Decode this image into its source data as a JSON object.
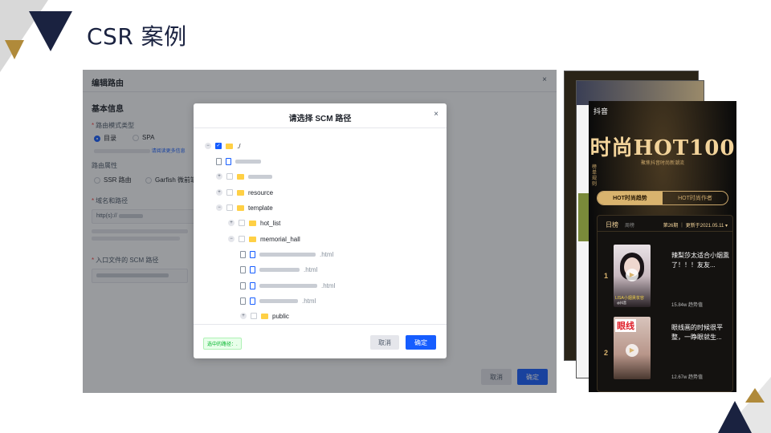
{
  "slide": {
    "title": "CSR 案例"
  },
  "drawer": {
    "title": "编辑路由",
    "close": "×",
    "section": "基本信息",
    "route_mode_label": "路由模式类型",
    "mode_options": [
      "目录",
      "SPA"
    ],
    "mode_hint_link": "请阅读更多信息",
    "route_attr_label": "路由属性",
    "attr_options": [
      "SSR 路由",
      "Garfish 微前端"
    ],
    "domain_label": "域名和路径",
    "domain_prefix": "http(s)://",
    "entry_label": "入口文件的 SCM 路径",
    "cancel": "取消",
    "confirm": "确定"
  },
  "modal": {
    "title": "请选择 SCM 路径",
    "close": "×",
    "root": "./",
    "tree": [
      {
        "label": "resource",
        "kind": "folder"
      },
      {
        "label": "template",
        "kind": "folder"
      },
      {
        "label": "hot_list",
        "kind": "folder"
      },
      {
        "label": "memorial_hall",
        "kind": "folder"
      },
      {
        "label": "public",
        "kind": "folder"
      }
    ],
    "file_suffixes": [
      ".html",
      ".html",
      ".html",
      ".html"
    ],
    "selected_tag": "选中的路径：.",
    "cancel": "取消",
    "confirm": "确定"
  },
  "phone": {
    "app": "抖音",
    "title": "时尚HOT100",
    "subtitle": "聚焦抖音时尚新潮流",
    "side_text": "榜单规则",
    "tabs": [
      "HOT时尚趋势",
      "HOT时尚作者"
    ],
    "board_daily": "日榜",
    "board_weekly": "周榜",
    "period": "第26期 ｜ 更新于2021.05.11 ▾",
    "items": [
      {
        "rank": "1",
        "text": "辣梨莎太适合小烟熏了！！！友友...",
        "heat": "15.84w 趋势值"
      },
      {
        "rank": "2",
        "text": "眼线画的时候很平整，一睁眼就生...",
        "heat": "12.67w 趋势值"
      }
    ],
    "thumb_labels": [
      "LISA小烟熏妆容",
      "眼线",
      "@抖音"
    ]
  }
}
